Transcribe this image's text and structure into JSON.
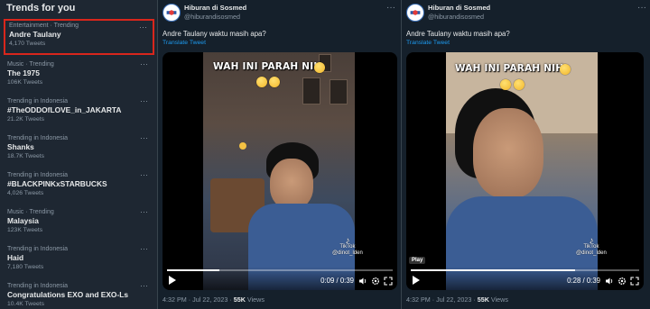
{
  "trends": {
    "title": "Trends for you",
    "more_glyph": "···",
    "items": [
      {
        "meta": "Entertainment · Trending",
        "name": "Andre Taulany",
        "count": "4,170 Tweets"
      },
      {
        "meta": "Music · Trending",
        "name": "The 1975",
        "count": "106K Tweets"
      },
      {
        "meta": "Trending in Indonesia",
        "name": "#TheODDOfLOVE_in_JAKARTA",
        "count": "21.2K Tweets"
      },
      {
        "meta": "Trending in Indonesia",
        "name": "Shanks",
        "count": "18.7K Tweets"
      },
      {
        "meta": "Trending in Indonesia",
        "name": "#BLACKPINKxSTARBUCKS",
        "count": "4,026 Tweets"
      },
      {
        "meta": "Music · Trending",
        "name": "Malaysia",
        "count": "123K Tweets"
      },
      {
        "meta": "Trending in Indonesia",
        "name": "Haid",
        "count": "7,180 Tweets"
      },
      {
        "meta": "Trending in Indonesia",
        "name": "Congratulations EXO and EXO-Ls",
        "count": "10.4K Tweets"
      }
    ]
  },
  "tweets": [
    {
      "username": "Hiburan di Sosmed",
      "handle": "@hiburandisosmed",
      "text": "Andre Taulany waktu masih apa?",
      "translate": "Translate Tweet",
      "video": {
        "caption": "WAH INI PARAH NIH",
        "tiktok_brand": "TikTok",
        "tiktok_handle": "@dinot_lden",
        "time": "0:09 / 0:39",
        "progress": 0.23
      },
      "timestamp": "4:32 PM · Jul 22, 2023 · ",
      "views": "55K",
      "views_label": " Views"
    },
    {
      "username": "Hiburan di Sosmed",
      "handle": "@hiburandisosmed",
      "text": "Andre Taulany waktu masih apa?",
      "translate": "Translate Tweet",
      "video": {
        "caption": "WAH INI PARAH NIH",
        "tiktok_brand": "TikTok",
        "tiktok_handle": "@dinot_lden",
        "play_badge": "Play",
        "time": "0:28 / 0:39",
        "progress": 0.72
      },
      "timestamp": "4:32 PM · Jul 22, 2023 · ",
      "views": "55K",
      "views_label": " Views"
    }
  ],
  "colors": {
    "accent": "#1d9bf0",
    "highlight_box": "#d9261c",
    "background": "#15202b",
    "panel": "#1e2732"
  },
  "icons": [
    "more-icon",
    "play-icon",
    "volume-icon",
    "settings-icon",
    "fullscreen-icon",
    "emoji-grin-icon",
    "tiktok-logo-icon"
  ]
}
